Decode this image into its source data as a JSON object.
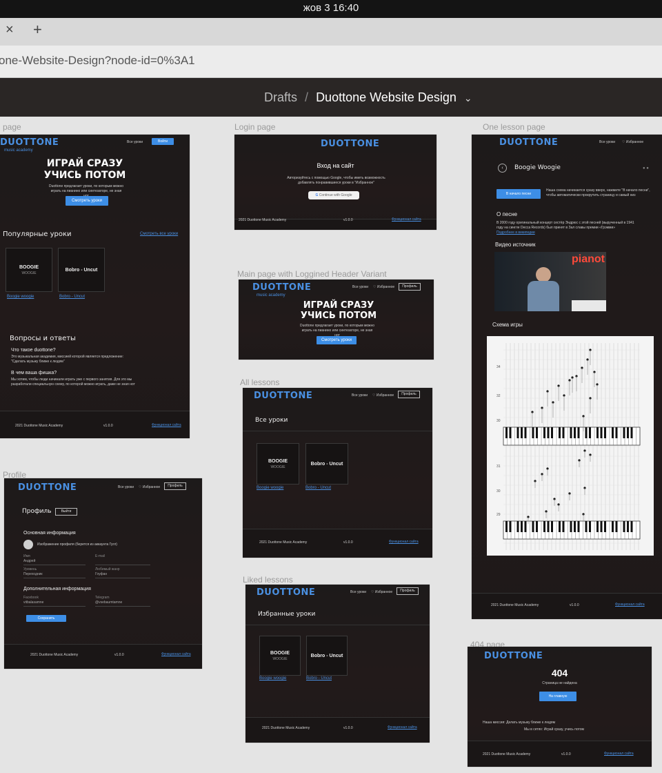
{
  "system_bar": {
    "clock": "жов 3  16:40"
  },
  "browser": {
    "close_tab": "×",
    "new_tab": "+",
    "url": "one-Website-Design?node-id=0%3A1"
  },
  "figma": {
    "breadcrumb_root": "Drafts",
    "separator": "/",
    "file_name": "Duottone Website Design",
    "chevron": "⌄"
  },
  "frames": {
    "main": {
      "label": "page",
      "logo": "DUOTTONE",
      "logo_sub": "music academy",
      "nav_lessons": "Все уроки",
      "nav_login": "Войти",
      "hero_line1": "ИГРАЙ СРАЗУ",
      "hero_line2": "УЧИСЬ ПОТОМ",
      "hero_text": "Duottone предлагает уроки, по которым можно играть на пианино или синтезаторе, не зная нот",
      "hero_button": "Смотреть уроки",
      "popular_title": "Популярные уроки",
      "see_all": "Смотреть все уроки",
      "cards": [
        {
          "title": "BOOGIE",
          "subtitle": "WOOGIE",
          "link": "Boogie woogie"
        },
        {
          "title": "Bobro - Uncut",
          "subtitle": "",
          "link": "Bobro - Uncut"
        }
      ],
      "faq_title": "Вопросы и ответы",
      "q1": "Что такое duottone?",
      "a1": "Это музыкальная академия, миссией которой является предложение: \"Сделать музыку ближе к людям\"",
      "q2": "В чем ваша фишка?",
      "a2": "Мы хотим, чтобы люди начинали играть уже с первого занятия. Для это мы разработали специальную схему, по которой можно играть, даже не зная нот",
      "footer_copy": "2021 Duottone Music Academy",
      "footer_version": "v1.0.0",
      "footer_link": "Функционал сайта"
    },
    "login": {
      "label": "Login page",
      "logo": "DUOTTONE",
      "title": "Вход на сайт",
      "text": "Авторизуйтесь с помощью Google, чтобы иметь возможность добавлять понравившиеся уроки в \"Избранное\"",
      "google_button": "Continue with Google",
      "footer_copy": "2021 Duottone Music Academy",
      "footer_version": "v1.0.0",
      "footer_link": "Функционал сайта"
    },
    "main_logged": {
      "label": "Main page with Loggined Header Variant",
      "logo": "DUOTTONE",
      "logo_sub": "music academy",
      "nav_lessons": "Все уроки",
      "nav_fav": "♡ Избранное",
      "nav_profile": "Профиль",
      "hero_line1": "ИГРАЙ СРАЗУ",
      "hero_line2": "УЧИСЬ ПОТОМ",
      "hero_text": "Duottone предлагает уроки, по которым можно играть на пианино или синтезаторе, не зная нот",
      "hero_button": "Смотреть уроки"
    },
    "all_lessons": {
      "label": "All lessons",
      "logo": "DUOTTONE",
      "nav_lessons": "Все уроки",
      "nav_fav": "♡ Избранное",
      "nav_profile": "Профиль",
      "title": "Все уроки",
      "cards": [
        {
          "title": "BOOGIE",
          "subtitle": "WOOGIE",
          "link": "Boogie woogie"
        },
        {
          "title": "Bobro - Uncut",
          "subtitle": "",
          "link": "Bobro - Uncut"
        }
      ],
      "footer_copy": "2021 Duottone Music Academy",
      "footer_version": "v1.0.0",
      "footer_link": "Функционал сайта"
    },
    "liked": {
      "label": "Liked lessons",
      "logo": "DUOTTONE",
      "nav_lessons": "Все уроки",
      "nav_fav": "♡ Избранное",
      "nav_profile": "Профиль",
      "title": "Избранные уроки",
      "cards": [
        {
          "title": "BOOGIE",
          "subtitle": "WOOGIE",
          "link": "Boogie woogie"
        },
        {
          "title": "Bobro - Uncut",
          "subtitle": "",
          "link": "Bobro - Uncut"
        }
      ],
      "footer_copy": "2021 Duottone Music Academy",
      "footer_version": "v1.0.0",
      "footer_link": "Функционал сайта"
    },
    "profile": {
      "label": "Profile",
      "logo": "DUOTTONE",
      "nav_lessons": "Все уроки",
      "nav_fav": "♡ Избранное",
      "nav_profile": "Профиль",
      "title": "Профиль",
      "logout": "Выйти",
      "basic_title": "Основная информация",
      "avatar_text": "Изображение профиля (берется из аккаунта Гугл)",
      "name_label": "Имя",
      "name_value": "Андрей",
      "email_label": "E-mail",
      "email_value": "",
      "level_label": "Уровень",
      "level_value": "Переходник",
      "genre_label": "Любимый жанр",
      "genre_value": "Гоуфан",
      "extra_title": "Дополнительная информация",
      "fb_label": "Facebook",
      "fb_value": "vitbalasamne",
      "tg_label": "Telegram",
      "tg_value": "@vsebaumtamne",
      "save": "Сохранить",
      "footer_copy": "2021 Duottone Music Academy",
      "footer_version": "v1.0.0",
      "footer_link": "Функционал сайта"
    },
    "lesson": {
      "label": "One lesson page",
      "logo": "DUOTTONE",
      "nav_lessons": "Все уроки",
      "nav_fav": "♡ Избранное",
      "title": "Boogie Woogie",
      "fav_button": "В начало песни",
      "fav_hint": "Наша схема начинается сразу вверх, нажмите \"В начало песни\", чтобы автоматически прокрутить страницу и самый низ",
      "about_title": "О песне",
      "about_text": "В 2000 году оригинальный концерт сестёр Эндрюс с этой песней (вырученный в 1941 году на сингле Decca Records) был принят в Зал славы премии «Грэмми»",
      "about_link": "Подробнее в википедии",
      "video_title": "Видео источник",
      "video_brand": "pianot",
      "scheme_title": "Схема игры",
      "scheme_ticks_top": [
        "34",
        "32",
        "30"
      ],
      "scheme_ticks_bottom": [
        "31",
        "30",
        "29"
      ],
      "footer_copy": "2021 Duottone Music Academy",
      "footer_version": "v1.0.0",
      "footer_link": "Функционал сайта"
    },
    "notfound": {
      "label": "404 page",
      "logo": "DUOTTONE",
      "code": "404",
      "text": "Страница не найдена",
      "button": "На главную",
      "mission": "Наша миссия: Делать музыку ближе к людям",
      "credit": "Мы в сетях: Играй сразу, учись потом",
      "footer_copy": "2021 Duottone Music Academy",
      "footer_version": "v1.0.0",
      "footer_link": "Функционал сайта"
    }
  },
  "colors": {
    "accent": "#3d8ee6",
    "frame_bg": "#1f1a1a",
    "canvas": "#e4e4e4",
    "figma_bar": "#2a2625"
  }
}
